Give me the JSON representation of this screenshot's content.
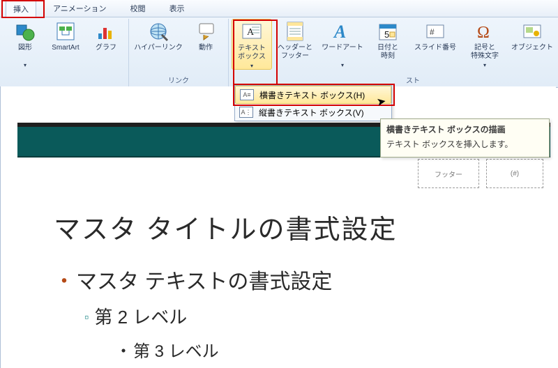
{
  "tabs": {
    "insert": "挿入",
    "animation": "アニメーション",
    "review": "校閲",
    "view": "表示"
  },
  "ribbon": {
    "shapes": "図形",
    "smartart": "SmartArt",
    "chart": "グラフ",
    "hyperlink": "ハイパーリンク",
    "action": "動作",
    "textbox": "テキスト\nボックス",
    "headerfooter": "ヘッダーと\nフッター",
    "wordart": "ワードアート",
    "datetime": "日付と\n時刻",
    "slidenumber": "スライド番号",
    "symbol": "記号と\n特殊文字",
    "object": "オブジェクト",
    "group_links": "リンク",
    "group_text_tail": "スト"
  },
  "dropdown": {
    "horizontal": "横書きテキスト ボックス(H)",
    "vertical": "縦書きテキスト ボックス(V)"
  },
  "tooltip": {
    "title": "横書きテキスト ボックスの描画",
    "body": "テキスト ボックスを挿入します。"
  },
  "placeholders": {
    "footer": "フッター",
    "number": "(#)"
  },
  "slide": {
    "title": "マスタ タイトルの書式設定",
    "level1": "マスタ テキストの書式設定",
    "level2": "第 2 レベル",
    "level3": "第 3 レベル"
  }
}
